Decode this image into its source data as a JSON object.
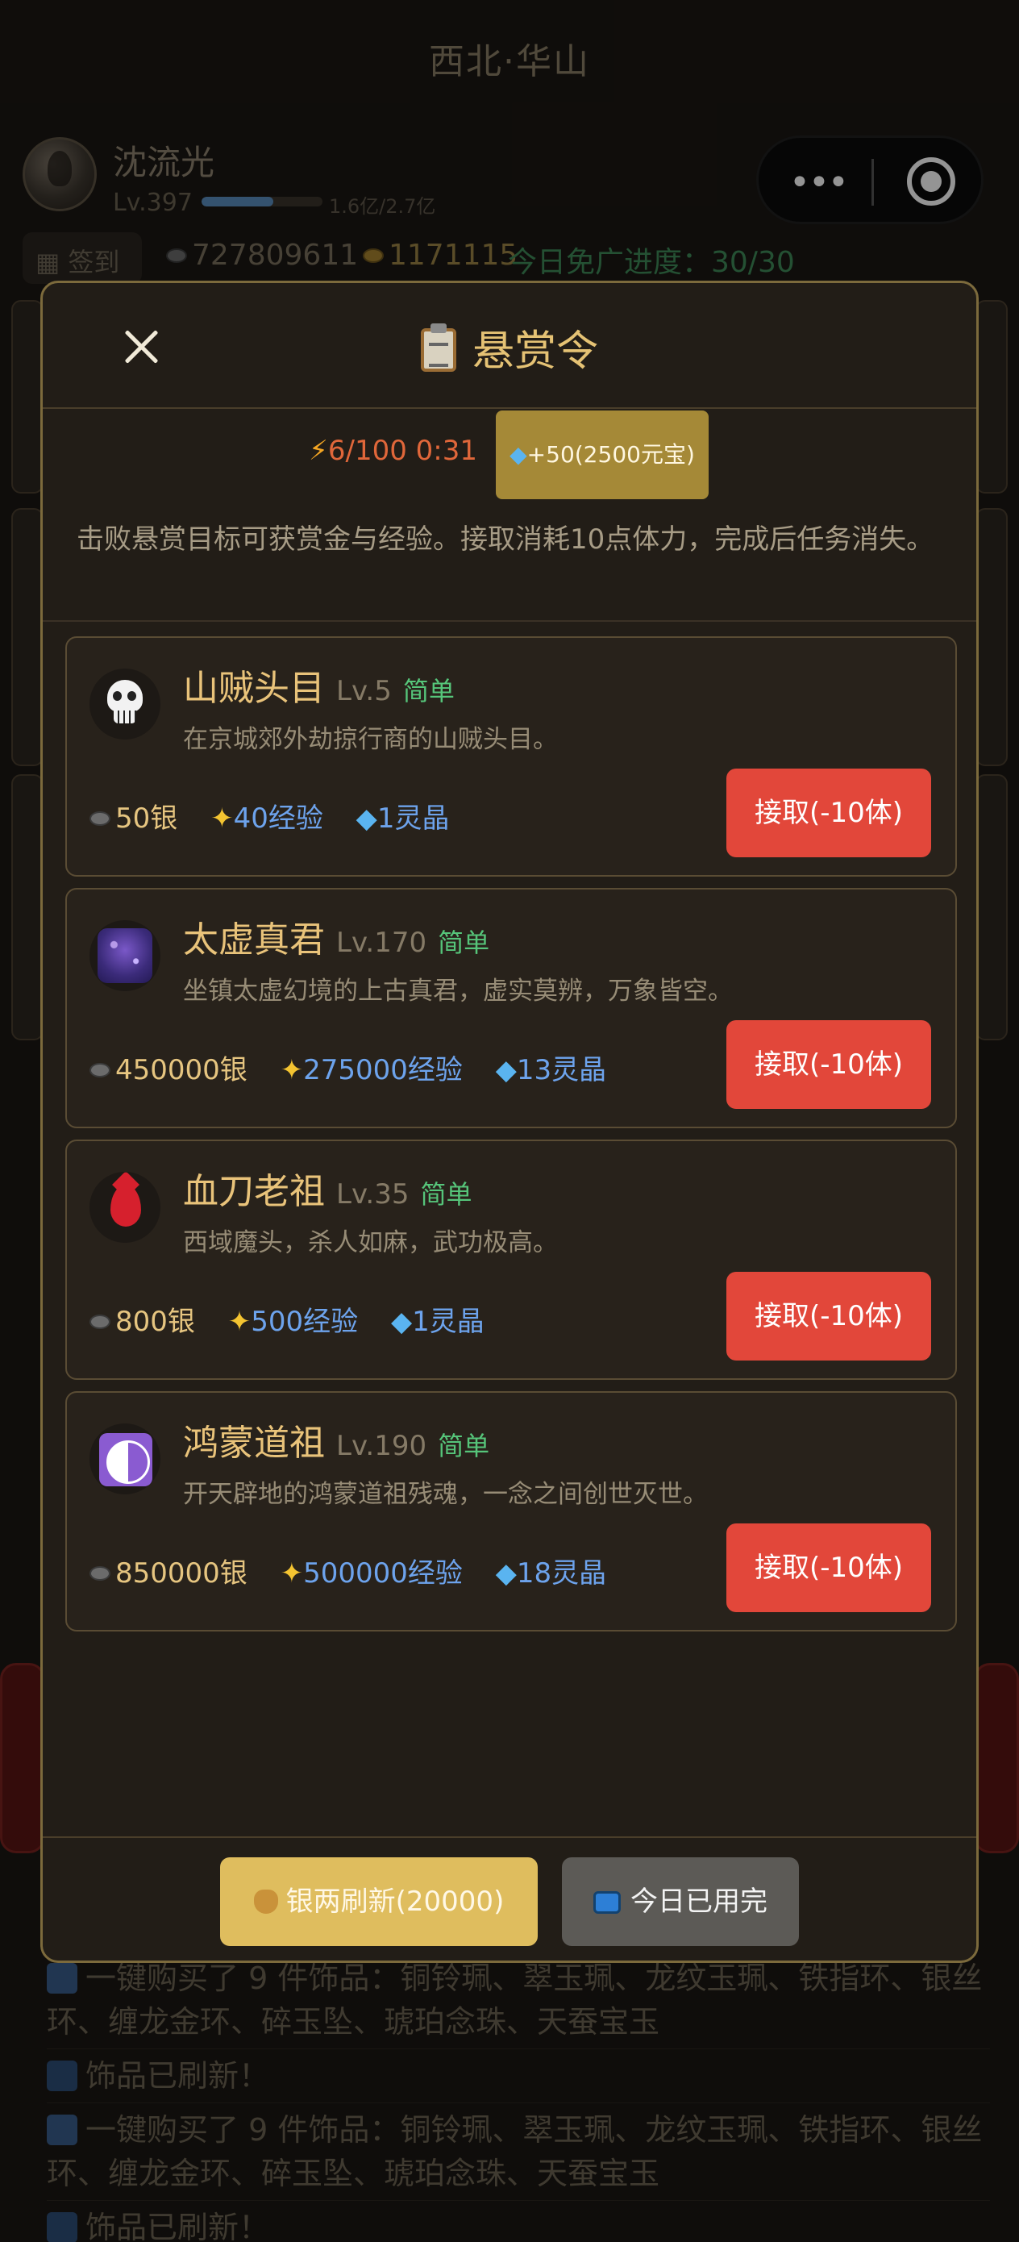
{
  "location": "西北·华山",
  "player": {
    "name": "沈流光",
    "level": "Lv.397",
    "exp_text": "1.6亿/2.7亿",
    "exp_progress": 0.59
  },
  "status": {
    "checkin_label": "签到",
    "silver": "727809611",
    "gold": "1171115",
    "ad_progress": "今日免广进度：30/30"
  },
  "modal": {
    "title": "悬赏令",
    "energy": "6/100 0:31",
    "buy_energy_label": "+50(2500元宝)",
    "description": "击败悬赏目标可获赏金与经验。接取消耗10点体力，完成后任务消失。",
    "bounties": [
      {
        "name": "山贼头目",
        "level": "Lv.5",
        "difficulty": "简单",
        "desc": "在京城郊外劫掠行商的山贼头目。",
        "silver": "50银",
        "exp": "40经验",
        "crystal": "1灵晶",
        "accept": "接取(-10体)",
        "icon": "skull-icon"
      },
      {
        "name": "太虚真君",
        "level": "Lv.170",
        "difficulty": "简单",
        "desc": "坐镇太虚幻境的上古真君，虚实莫辨，万象皆空。",
        "silver": "450000银",
        "exp": "275000经验",
        "crystal": "13灵晶",
        "accept": "接取(-10体)",
        "icon": "galaxy-icon"
      },
      {
        "name": "血刀老祖",
        "level": "Lv.35",
        "difficulty": "简单",
        "desc": "西域魔头，杀人如麻，武功极高。",
        "silver": "800银",
        "exp": "500经验",
        "crystal": "1灵晶",
        "accept": "接取(-10体)",
        "icon": "blood-drop-icon"
      },
      {
        "name": "鸿蒙道祖",
        "level": "Lv.190",
        "difficulty": "简单",
        "desc": "开天辟地的鸿蒙道祖残魂，一念之间创世灭世。",
        "silver": "850000银",
        "exp": "500000经验",
        "crystal": "18灵晶",
        "accept": "接取(-10体)",
        "icon": "yin-yang-icon"
      }
    ],
    "refresh_label": "银两刷新(20000)",
    "ad_label": "今日已用完"
  },
  "log": [
    "一键购买了 9 件饰品：铜铃珮、翠玉珮、龙纹玉珮、铁指环、银丝环、缠龙金环、碎玉坠、琥珀念珠、天蚕宝玉",
    "饰品已刷新！",
    "一键购买了 9 件饰品：铜铃珮、翠玉珮、龙纹玉珮、铁指环、银丝环、缠龙金环、碎玉坠、琥珀念珠、天蚕宝玉",
    "饰品已刷新！"
  ],
  "colors": {
    "accent_gold": "#e5c274",
    "accept_red": "#e2473a",
    "difficulty_green": "#56c57a",
    "exp_blue": "#6da3ec"
  }
}
